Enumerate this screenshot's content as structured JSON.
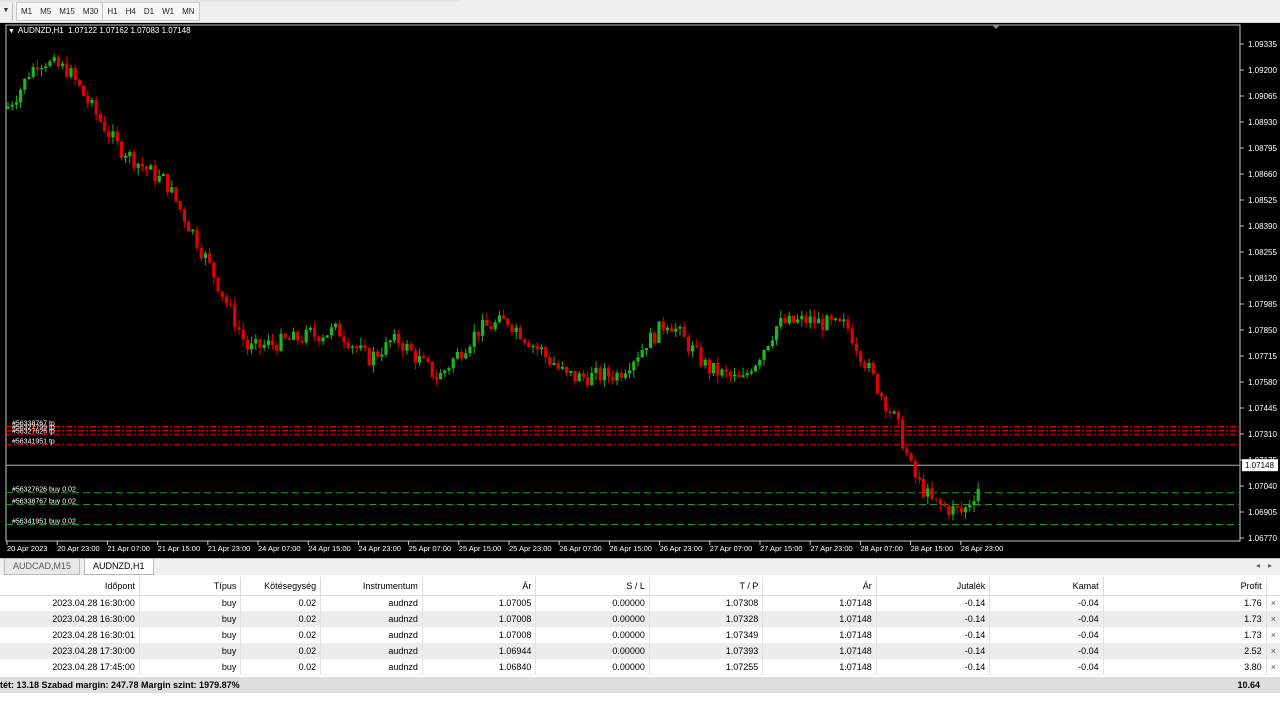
{
  "toolbar": {
    "timeframes": [
      "M1",
      "M5",
      "M15",
      "M30",
      "H1",
      "H4",
      "D1",
      "W1",
      "MN"
    ]
  },
  "chart": {
    "symbol_header": "AUDNZD,H1",
    "ohlc": "1.07122 1.07162 1.07083 1.07148",
    "current_price_label": "1.07148",
    "price_axis": [
      "1.09335",
      "1.09200",
      "1.09065",
      "1.08930",
      "1.08795",
      "1.08660",
      "1.08525",
      "1.08390",
      "1.08255",
      "1.08120",
      "1.07985",
      "1.07850",
      "1.07715",
      "1.07580",
      "1.07445",
      "1.07310",
      "1.07175",
      "1.07040",
      "1.06905",
      "1.06770"
    ],
    "time_axis": [
      "20 Apr 2023",
      "20 Apr 23:00",
      "21 Apr 07:00",
      "21 Apr 15:00",
      "21 Apr 23:00",
      "24 Apr 07:00",
      "24 Apr 15:00",
      "24 Apr 23:00",
      "25 Apr 07:00",
      "25 Apr 15:00",
      "25 Apr 23:00",
      "26 Apr 07:00",
      "26 Apr 15:00",
      "26 Apr 23:00",
      "27 Apr 07:00",
      "27 Apr 15:00",
      "27 Apr 23:00",
      "28 Apr 07:00",
      "28 Apr 15:00",
      "28 Apr 23:00"
    ],
    "order_lines": [
      {
        "label": "#56338767 tp",
        "price": 1.07349,
        "kind": "tp"
      },
      {
        "label": "#56327799 tp",
        "price": 1.07328,
        "kind": "tp"
      },
      {
        "label": "#56327626 tp",
        "price": 1.07308,
        "kind": "tp"
      },
      {
        "label": "#56341951 tp",
        "price": 1.07255,
        "kind": "tp"
      },
      {
        "label": "#56327626 buy 0.02",
        "price": 1.07005,
        "kind": "entry"
      },
      {
        "label": "#56338767 buy 0.02",
        "price": 1.06944,
        "kind": "entry"
      },
      {
        "label": "#56341951 buy 0.02",
        "price": 1.0684,
        "kind": "entry"
      }
    ],
    "colors": {
      "bull": "#1fb51f",
      "bear": "#e00000",
      "tp_line": "#cc0000",
      "entry_line": "#1f9a1f",
      "price_line": "#b0b0c8"
    }
  },
  "tabs": [
    {
      "label": "AUDCAD,M15",
      "active": false
    },
    {
      "label": "AUDNZD,H1",
      "active": true
    }
  ],
  "positions": {
    "headers": [
      "Időpont",
      "Típus",
      "Kötésegység",
      "Instrumentum",
      "Ár",
      "S / L",
      "T / P",
      "Ár",
      "Jutalék",
      "Kamat",
      "Profit"
    ],
    "rows": [
      [
        "2023.04.28 16:30:00",
        "buy",
        "0.02",
        "audnzd",
        "1.07005",
        "0.00000",
        "1.07308",
        "1.07148",
        "-0.14",
        "-0.04",
        "1.76"
      ],
      [
        "2023.04.28 16:30:00",
        "buy",
        "0.02",
        "audnzd",
        "1.07008",
        "0.00000",
        "1.07328",
        "1.07148",
        "-0.14",
        "-0.04",
        "1.73"
      ],
      [
        "2023.04.28 16:30:01",
        "buy",
        "0.02",
        "audnzd",
        "1.07008",
        "0.00000",
        "1.07349",
        "1.07148",
        "-0.14",
        "-0.04",
        "1.73"
      ],
      [
        "2023.04.28 17:30:00",
        "buy",
        "0.02",
        "audnzd",
        "1.06944",
        "0.00000",
        "1.07393",
        "1.07148",
        "-0.14",
        "-0.04",
        "2.52"
      ],
      [
        "2023.04.28 17:45:00",
        "buy",
        "0.02",
        "audnzd",
        "1.06840",
        "0.00000",
        "1.07255",
        "1.07148",
        "-0.14",
        "-0.04",
        "3.80"
      ]
    ],
    "close_icon": "×",
    "summary_left": "tét: 13.18  Szabad margin: 247.78  Margin szint: 1979.87%",
    "summary_total": "10.64"
  }
}
